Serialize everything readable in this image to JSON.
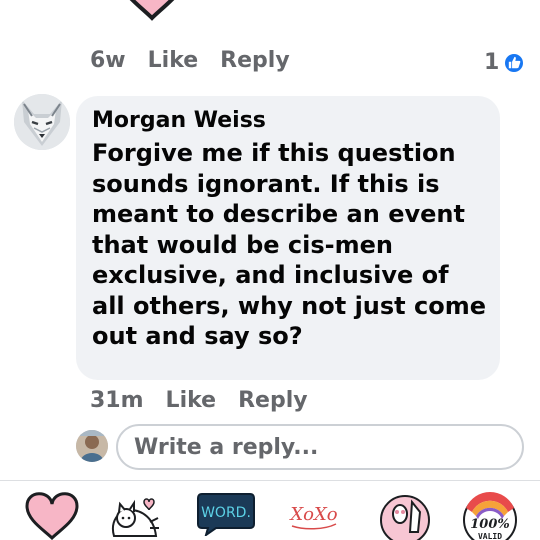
{
  "comment_above": {
    "time": "6w",
    "like_label": "Like",
    "reply_label": "Reply",
    "reaction_count": "1",
    "reaction_icon": "like-thumb-icon"
  },
  "comment": {
    "author": "Morgan Weiss",
    "text": "Forgive me if this question sounds ignorant.  If this is meant to describe an event that would be cis-men exclusive, and inclusive of all others, why not just come out and say so?",
    "time": "31m",
    "like_label": "Like",
    "reply_label": "Reply"
  },
  "reply_box": {
    "placeholder": "Write a reply..."
  },
  "sticker_tray": {
    "items": [
      {
        "name": "heart-sticker",
        "text": ""
      },
      {
        "name": "cat-sticker",
        "text": ""
      },
      {
        "name": "word-sticker",
        "text": "WORD."
      },
      {
        "name": "xoxo-sticker",
        "text": "XoXo"
      },
      {
        "name": "paw-sticker",
        "text": ""
      },
      {
        "name": "valid-sticker",
        "text": "100%",
        "text2": "VALID"
      }
    ]
  },
  "colors": {
    "brand_blue": "#1877f2",
    "bubble_bg": "#f0f2f5",
    "heart_pink": "#f7b6c6",
    "secondary_text": "#65676b"
  }
}
